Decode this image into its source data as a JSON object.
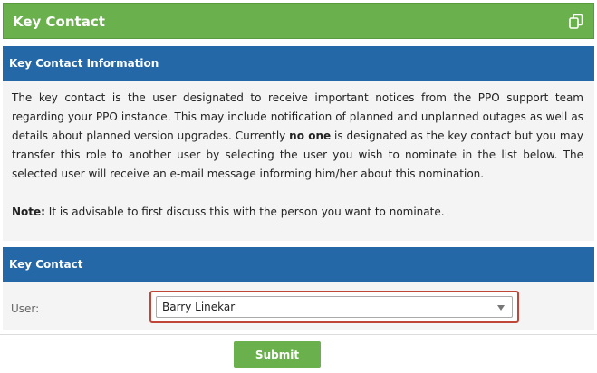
{
  "header": {
    "title": "Key Contact",
    "icon": "copy-icon"
  },
  "info_panel": {
    "title": "Key Contact Information",
    "paragraph_part1": "The key contact is the user designated to receive important notices from the PPO support team regarding your PPO instance. This may include notification of planned and unplanned outages as well as details about planned version upgrades. Currently ",
    "paragraph_bold": "no one",
    "paragraph_part2": " is designated as the key contact but you may transfer this role to another user by selecting the user you wish to nominate in the list below. The selected user will receive an e-mail message informing him/her about this nomination.",
    "note_label": "Note:",
    "note_text": " It is advisable to first discuss this with the person you want to nominate."
  },
  "key_contact_panel": {
    "title": "Key Contact",
    "user_label": "User:",
    "user_selected": "Barry Linekar"
  },
  "actions": {
    "submit_label": "Submit"
  },
  "colors": {
    "header_green": "#6ab04c",
    "panel_blue": "#2468a8",
    "highlight_red": "#c0463a"
  }
}
